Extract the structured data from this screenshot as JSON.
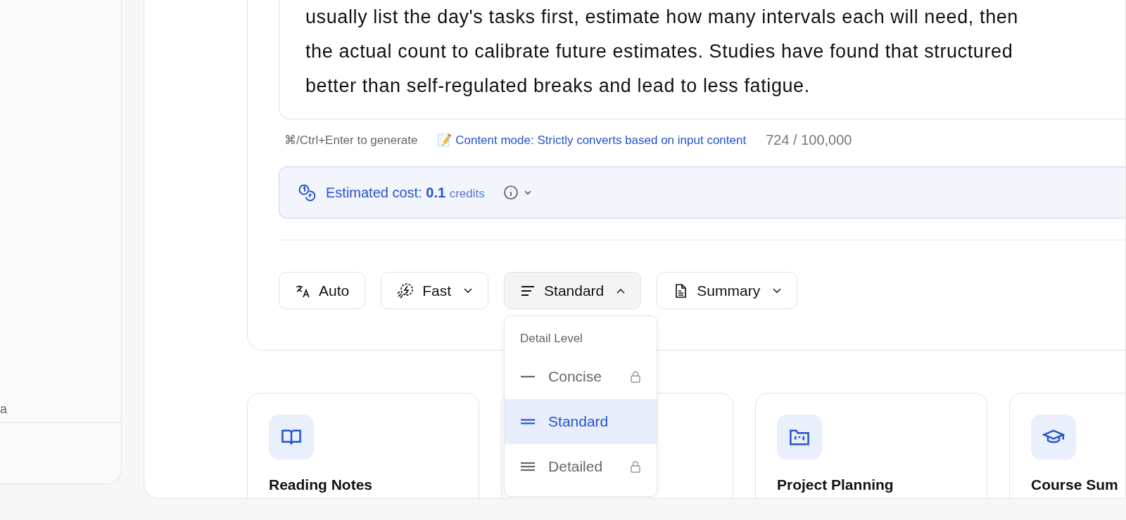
{
  "sidebar": {
    "fragment": "a"
  },
  "editor": {
    "text_lines": [
      "usually list the day's tasks first, estimate how many intervals each will need, then",
      "the actual count to calibrate future estimates. Studies have found that structured",
      "better than self-regulated breaks and lead to less fatigue."
    ],
    "shortcut_hint": "⌘/Ctrl+Enter to generate",
    "mode_note": "📝 Content mode: Strictly converts based on input content",
    "char_count": "724 / 100,000"
  },
  "cost": {
    "label": "Estimated cost:",
    "amount": "0.1",
    "unit": "credits",
    "details_expanded": false
  },
  "options": [
    {
      "kind": "language",
      "label": "Auto",
      "dropdown": false
    },
    {
      "kind": "speed",
      "label": "Fast",
      "dropdown": true,
      "expanded": false
    },
    {
      "kind": "detail",
      "label": "Standard",
      "dropdown": true,
      "expanded": true
    },
    {
      "kind": "format",
      "label": "Summary",
      "dropdown": true,
      "expanded": false
    }
  ],
  "detail_menu": {
    "heading": "Detail Level",
    "items": [
      {
        "label": "Concise",
        "selected": false,
        "locked": true
      },
      {
        "label": "Standard",
        "selected": true,
        "locked": false
      },
      {
        "label": "Detailed",
        "selected": false,
        "locked": true
      }
    ]
  },
  "templates": [
    {
      "kind": "book",
      "title": "Reading Notes"
    },
    {
      "kind": "none"
    },
    {
      "kind": "folder",
      "title": "Project Planning"
    },
    {
      "kind": "cap",
      "title": "Course Sum"
    }
  ]
}
